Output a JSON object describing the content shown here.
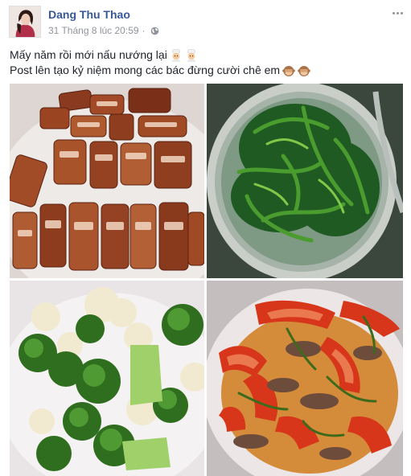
{
  "post": {
    "author_name": "Dang Thu Thao",
    "timestamp": "31 Tháng 8 lúc 20:59",
    "separator": "·",
    "privacy_icon": "globe-icon",
    "more_icon": "more-options-icon",
    "text_line_1": "Mấy năm rồi mới nấu nướng lại",
    "text_line_1_emojis": [
      "cook-emoji",
      "cook-emoji"
    ],
    "text_line_2": "Post lên tạo kỷ niệm mong các bác đừng cười chê em",
    "text_line_2_emojis": [
      "see-no-evil-monkey-emoji",
      "see-no-evil-monkey-emoji"
    ],
    "photos": [
      {
        "subject": "roast-pork-photo"
      },
      {
        "subject": "morning-glory-soup-photo"
      },
      {
        "subject": "broccoli-cauliflower-photo"
      },
      {
        "subject": "beef-tomato-stirfry-photo"
      }
    ]
  },
  "colors": {
    "author_link": "#365899",
    "meta_text": "#90949c",
    "body_text": "#1d2129",
    "border": "#dddfe2"
  }
}
